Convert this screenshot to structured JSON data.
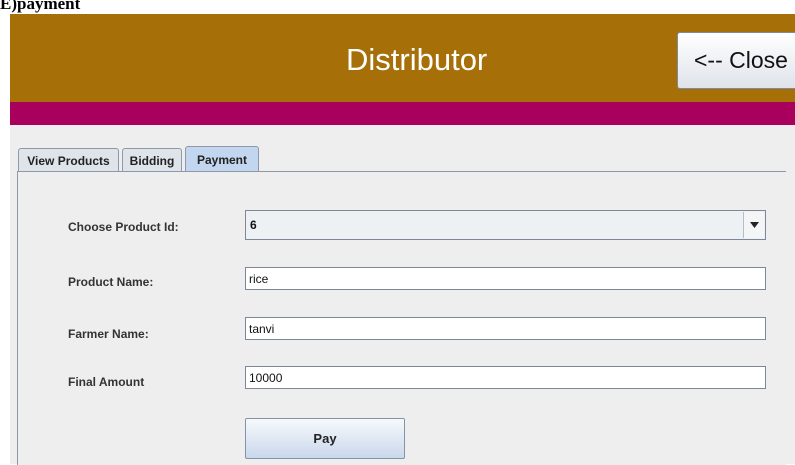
{
  "doc_heading": "E)payment",
  "window": {
    "title": "Distributor",
    "close_label": "<-- Close",
    "colors": {
      "header": "#a66f07",
      "band": "#a8005c"
    }
  },
  "tabs": [
    {
      "label": "View Products",
      "active": false
    },
    {
      "label": "Bidding",
      "active": false
    },
    {
      "label": "Payment",
      "active": true
    }
  ],
  "form": {
    "product_id_label": "Choose Product Id:",
    "product_id_value": "6",
    "product_name_label": "Product Name:",
    "product_name_value": "rice",
    "farmer_name_label": "Farmer Name:",
    "farmer_name_value": "tanvi",
    "final_amount_label": "Final Amount",
    "final_amount_value": "10000",
    "pay_label": "Pay"
  }
}
